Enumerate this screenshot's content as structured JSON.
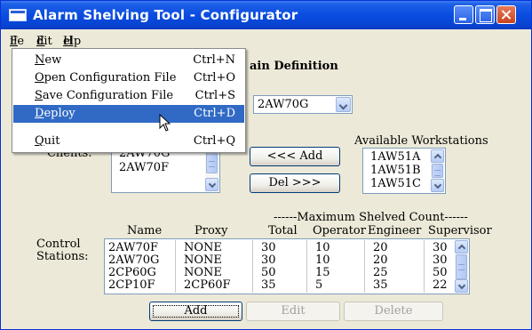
{
  "window": {
    "title": "Alarm Shelving Tool - Configurator"
  },
  "menubar": {
    "file": {
      "hotkey": "F",
      "rest": "ile"
    },
    "edit": {
      "hotkey": "E",
      "rest": "dit"
    },
    "help": {
      "hotkey": "H",
      "rest": "elp"
    }
  },
  "file_menu": {
    "items": [
      {
        "hotkey": "N",
        "rest": "ew",
        "shortcut": "Ctrl+N"
      },
      {
        "hotkey": "O",
        "rest": "pen Configuration File",
        "shortcut": "Ctrl+O"
      },
      {
        "hotkey": "S",
        "rest": "ave Configuration File",
        "shortcut": "Ctrl+S"
      },
      {
        "hotkey": "D",
        "rest": "eploy",
        "shortcut": "Ctrl+D"
      },
      {
        "hotkey": "Q",
        "rest": "uit",
        "shortcut": "Ctrl+Q"
      }
    ],
    "selected_index": 3
  },
  "section": {
    "heading_partial": "ain Definition"
  },
  "domain_select": {
    "value": "2AW70G"
  },
  "clients": {
    "label": "Clients:",
    "items": [
      "2AW70G",
      "2AW70F"
    ]
  },
  "buttons": {
    "add_client": "<<< Add",
    "del_client": "Del >>>",
    "add": "Add",
    "edit": "Edit",
    "delete": "Delete"
  },
  "workstations": {
    "label": "Available Workstations",
    "items": [
      "1AW51A",
      "1AW51B",
      "1AW51C"
    ]
  },
  "stations": {
    "label_line1": "Control",
    "label_line2": "Stations:",
    "group_header": "------Maximum Shelved Count------",
    "headers": {
      "name": "Name",
      "proxy": "Proxy",
      "total": "Total",
      "operator": "Operator",
      "engineer": "Engineer",
      "supervisor": "Supervisor"
    },
    "rows": [
      {
        "name": "2AW70F",
        "proxy": "NONE",
        "total": "30",
        "operator": "10",
        "engineer": "20",
        "supervisor": "30"
      },
      {
        "name": "2AW70G",
        "proxy": "NONE",
        "total": "30",
        "operator": "10",
        "engineer": "20",
        "supervisor": "30"
      },
      {
        "name": "2CP60G",
        "proxy": "NONE",
        "total": "50",
        "operator": "15",
        "engineer": "25",
        "supervisor": "50"
      },
      {
        "name": "2CP10F",
        "proxy": "2CP60F",
        "total": "35",
        "operator": "5",
        "engineer": "35",
        "supervisor": "22"
      }
    ]
  },
  "colors": {
    "titlebar": "#0a4ce0",
    "menu_highlight": "#316ac5",
    "window_bg": "#ece9d8"
  }
}
